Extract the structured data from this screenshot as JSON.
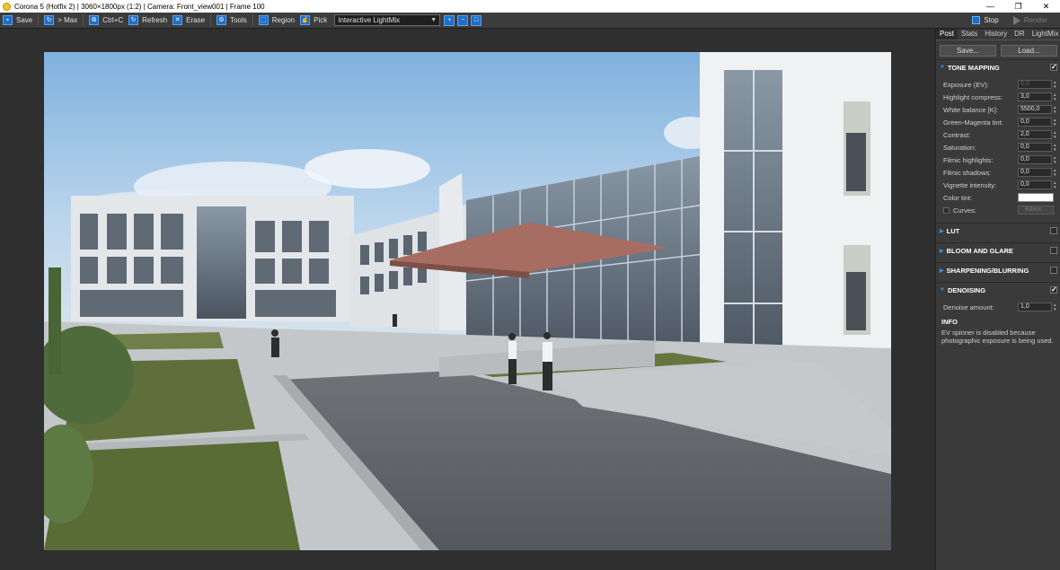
{
  "window": {
    "title": "Corona 5 (Hotfix 2) | 3060×1800px (1:2) | Camera: Front_view001 | Frame 100",
    "controls": [
      "—",
      "❐",
      "✕"
    ]
  },
  "toolbar": {
    "save": "Save",
    "max": "> Max",
    "copy": "Ctrl+C",
    "refresh": "Refresh",
    "erase": "Erase",
    "tools": "Tools",
    "region": "Region",
    "pick": "Pick",
    "lightmix_value": "Interactive LightMix",
    "stop": "Stop",
    "render": "Render"
  },
  "panel": {
    "tabs": [
      "Post",
      "Stats",
      "History",
      "DR",
      "LightMix"
    ],
    "save_btn": "Save...",
    "load_btn": "Load...",
    "tone_mapping": {
      "title": "TONE MAPPING",
      "checked": "✓",
      "params": [
        {
          "label": "Exposure (EV):",
          "value": "0,0"
        },
        {
          "label": "Highlight compress:",
          "value": "3,0"
        },
        {
          "label": "White balance [K]:",
          "value": "5500,0"
        },
        {
          "label": "Green-Magenta tint:",
          "value": "0,0"
        },
        {
          "label": "Contrast:",
          "value": "2,0"
        },
        {
          "label": "Saturation:",
          "value": "0,0"
        },
        {
          "label": "Filmic highlights:",
          "value": "0,0"
        },
        {
          "label": "Filmic shadows:",
          "value": "0,0"
        },
        {
          "label": "Vignette intensity:",
          "value": "0,0"
        }
      ],
      "color_tint_label": "Color tint:",
      "curves_label": "Curves:",
      "editor_label": "Editor..."
    },
    "lut": "LUT",
    "bloom": "BLOOM AND GLARE",
    "sharpening": "SHARPENING/BLURRING",
    "denoising": {
      "title": "DENOISING",
      "checked": "✓",
      "label": "Denoise amount:",
      "value": "1,0"
    },
    "info": {
      "title": "INFO",
      "text": "EV spinner is disabled because photographic exposure is being used."
    }
  }
}
